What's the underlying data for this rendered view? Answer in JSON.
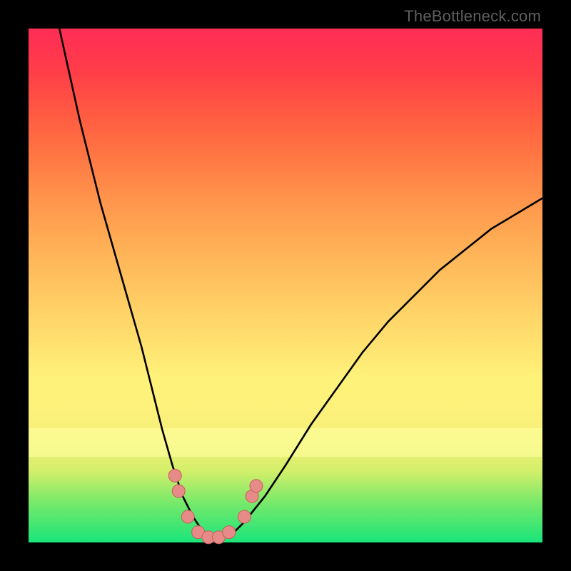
{
  "credit": "TheBottleneck.com",
  "colors": {
    "frame": "#000000",
    "gradient_top": "#ff2d55",
    "gradient_mid": "#ffd267",
    "gradient_bottom": "#19e57a",
    "curve": "#000000",
    "marker_fill": "#e78b89",
    "marker_stroke": "#c85e58"
  },
  "chart_data": {
    "type": "line",
    "title": "",
    "xlabel": "",
    "ylabel": "",
    "xlim": [
      0,
      100
    ],
    "ylim": [
      0,
      100
    ],
    "series": [
      {
        "name": "bottleneck-curve",
        "x": [
          6,
          10,
          14,
          18,
          22,
          24,
          26,
          28,
          30,
          32,
          34,
          36,
          38,
          40,
          42,
          46,
          50,
          55,
          60,
          65,
          70,
          75,
          80,
          85,
          90,
          95,
          100
        ],
        "y": [
          100,
          82,
          66,
          52,
          38,
          30,
          22,
          15,
          9,
          5,
          2,
          1,
          1,
          2,
          4,
          9,
          15,
          23,
          30,
          37,
          43,
          48,
          53,
          57,
          61,
          64,
          67
        ]
      }
    ],
    "markers": [
      {
        "x": 28.5,
        "y": 13
      },
      {
        "x": 29.2,
        "y": 10
      },
      {
        "x": 31,
        "y": 5
      },
      {
        "x": 33,
        "y": 2
      },
      {
        "x": 35,
        "y": 1
      },
      {
        "x": 37,
        "y": 1
      },
      {
        "x": 39,
        "y": 2
      },
      {
        "x": 42,
        "y": 5
      },
      {
        "x": 43.5,
        "y": 9
      },
      {
        "x": 44.3,
        "y": 11
      }
    ]
  }
}
